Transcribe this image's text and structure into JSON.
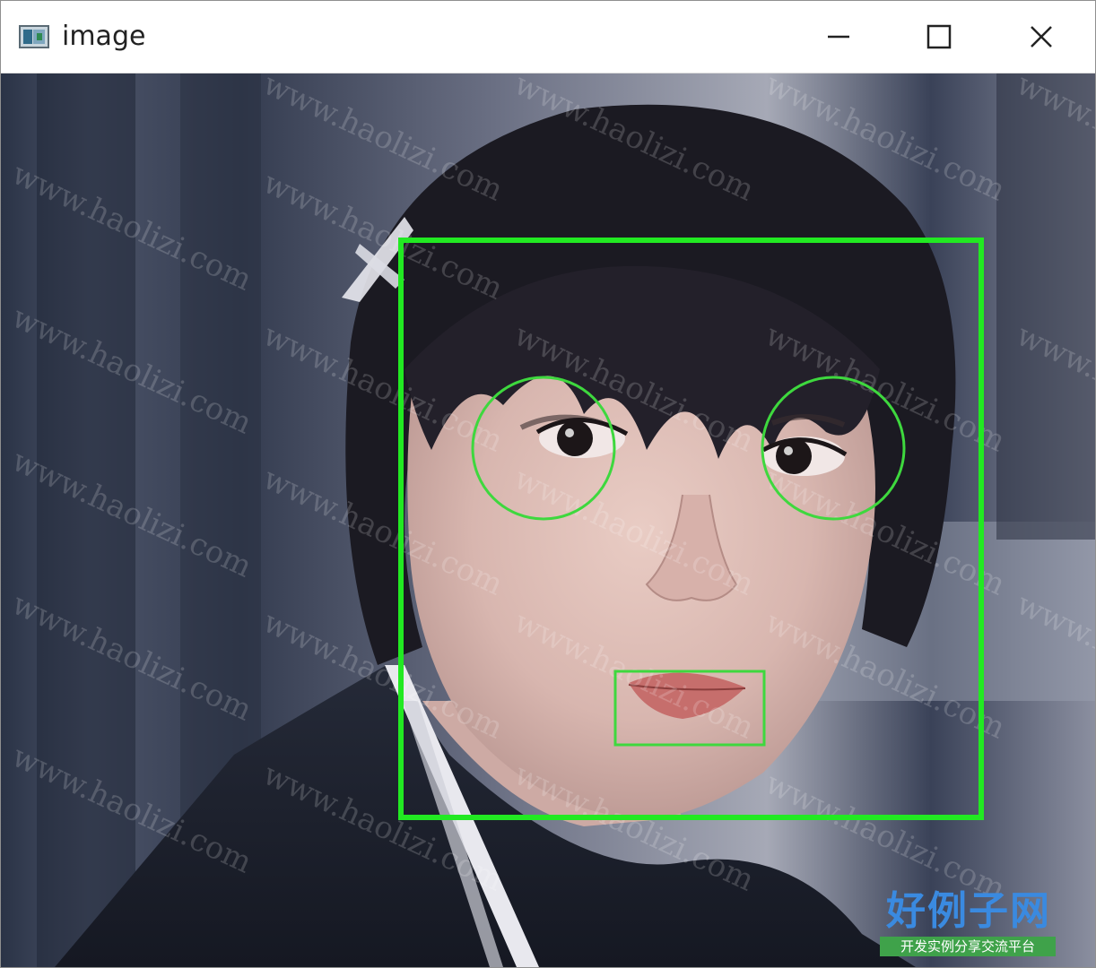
{
  "window": {
    "title": "image",
    "controls": {
      "minimize": "minimize-icon",
      "maximize": "maximize-icon",
      "close": "close-icon"
    }
  },
  "overlay": {
    "box_color": "#22e922",
    "detections": [
      "face",
      "left-eye",
      "right-eye",
      "mouth"
    ]
  },
  "watermark": {
    "url_text": "www.haolizi.com",
    "logo_title": "好例子网",
    "logo_subtitle": "开发实例分享交流平台"
  }
}
